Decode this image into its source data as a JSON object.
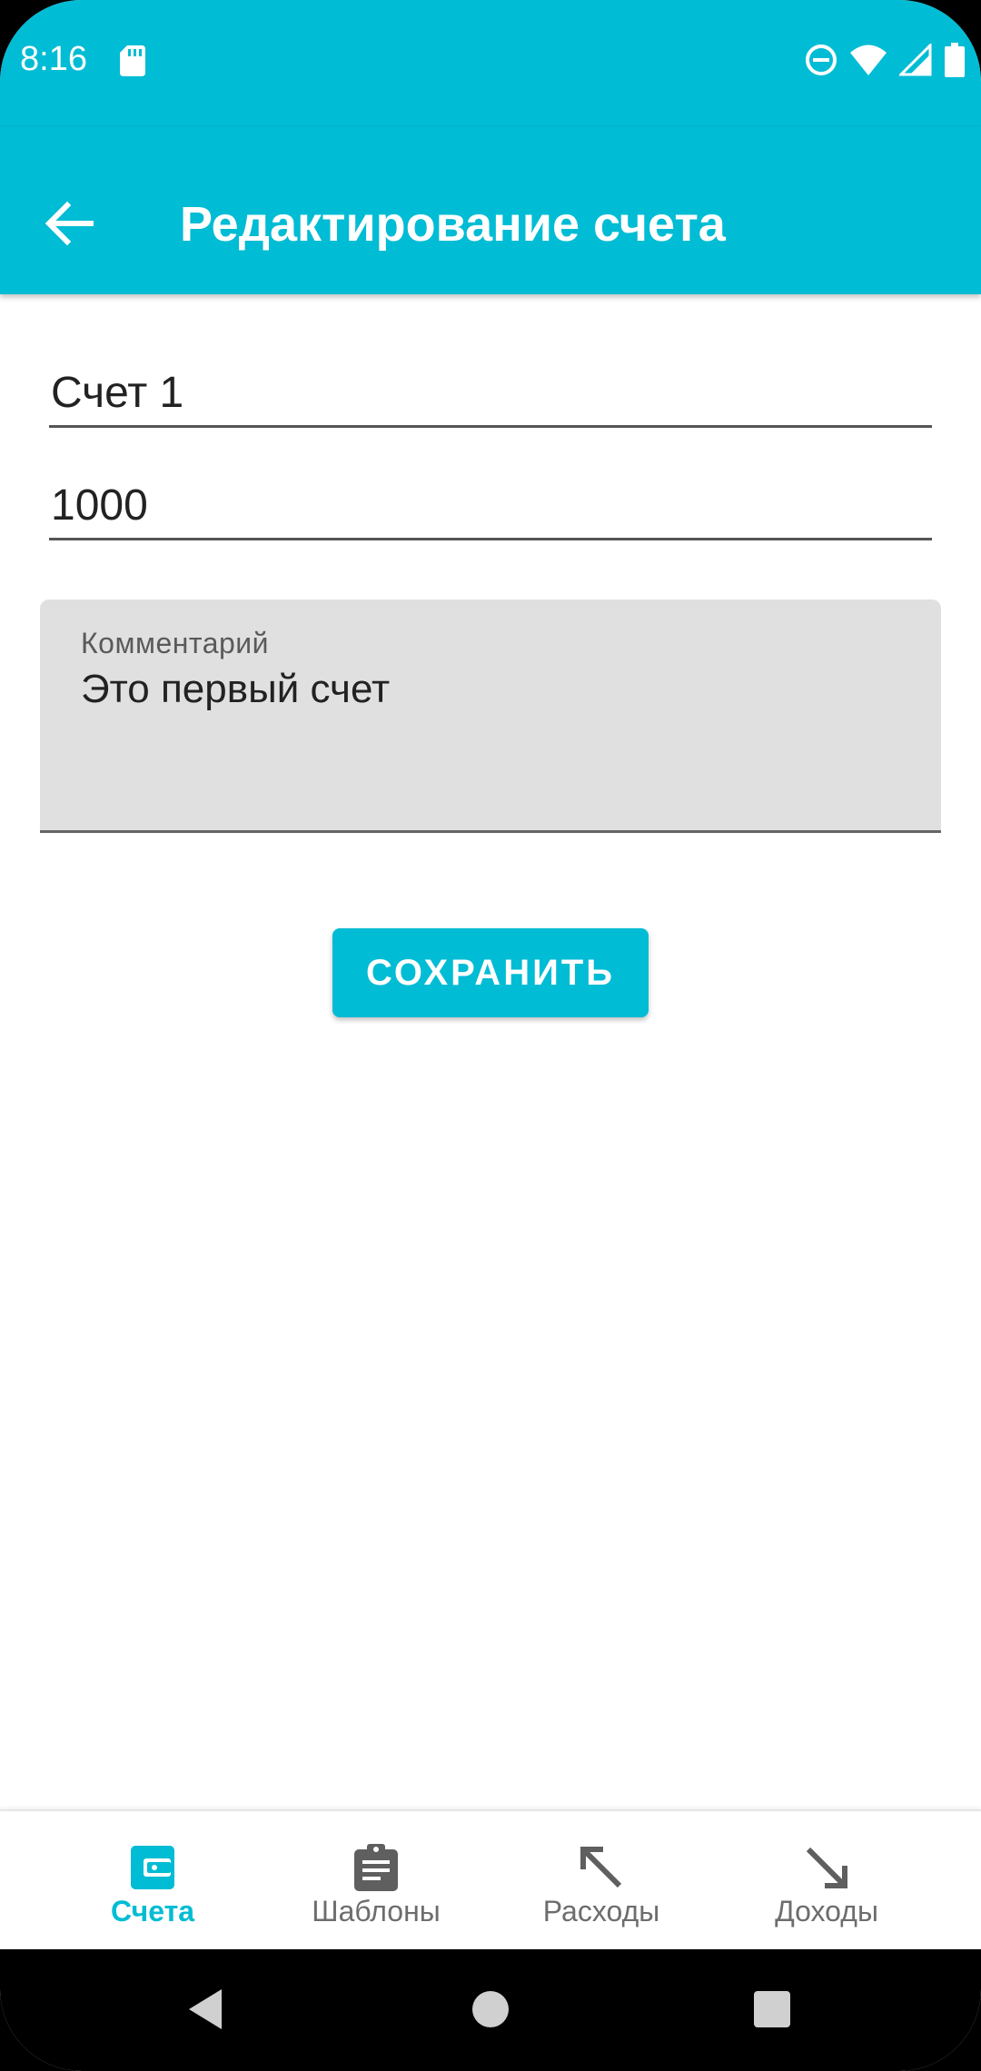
{
  "status_bar": {
    "time": "8:16",
    "icons": [
      "sd-card-icon",
      "do-not-disturb-icon",
      "wifi-icon",
      "cellular-signal-icon",
      "battery-icon"
    ]
  },
  "app_bar": {
    "title": "Редактирование счета",
    "back_icon": "arrow-back-icon"
  },
  "form": {
    "name_value": "Счет 1",
    "amount_value": "1000",
    "comment": {
      "label": "Комментарий",
      "value": "Это первый счет"
    },
    "save_label": "СОХРАНИТЬ"
  },
  "bottom_nav": {
    "items": [
      {
        "label": "Счета",
        "icon": "wallet-icon",
        "active": true
      },
      {
        "label": "Шаблоны",
        "icon": "clipboard-icon",
        "active": false
      },
      {
        "label": "Расходы",
        "icon": "arrow-up-left-icon",
        "active": false
      },
      {
        "label": "Доходы",
        "icon": "arrow-down-right-icon",
        "active": false
      }
    ]
  },
  "colors": {
    "primary": "#00BCD4",
    "text_primary": "#222222",
    "text_secondary": "#6d6d6d",
    "comment_background": "#e0e0e0"
  }
}
